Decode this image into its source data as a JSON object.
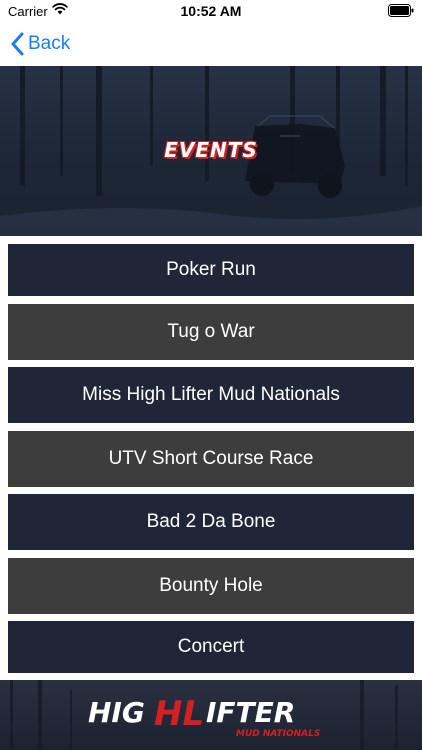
{
  "status_bar": {
    "carrier": "Carrier",
    "time": "10:52 AM",
    "icons": [
      "wifi-icon",
      "battery-icon"
    ]
  },
  "nav": {
    "back_label": "Back",
    "back_icon": "chevron-left-icon",
    "accent_color": "#1a7cf5"
  },
  "hero": {
    "title": "EVENTS",
    "title_color": "#ffffff",
    "title_outline_color": "#d42020"
  },
  "events": [
    {
      "label": "Poker Run",
      "color": "#1e2638"
    },
    {
      "label": "Tug o War",
      "color": "#3d3d3d"
    },
    {
      "label": "Miss High Lifter Mud Nationals",
      "color": "#1e2638"
    },
    {
      "label": "UTV Short Course Race",
      "color": "#3d3d3d"
    },
    {
      "label": "Bad 2 Da Bone",
      "color": "#1e2638"
    },
    {
      "label": "Bounty Hole",
      "color": "#3d3d3d"
    },
    {
      "label": "Concert",
      "color": "#1e2638"
    }
  ],
  "footer": {
    "logo_text_main_a": "HIG",
    "logo_text_hl": "HL",
    "logo_text_main_b": "IFTER",
    "logo_text_sub": "MUD NATIONALS"
  }
}
